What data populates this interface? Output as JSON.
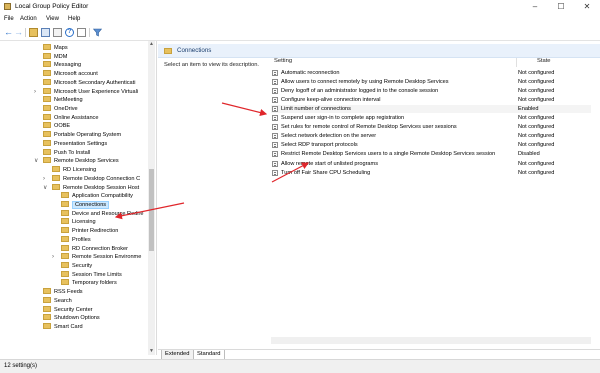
{
  "window": {
    "title": "Local Group Policy Editor",
    "min": "–",
    "max": "☐",
    "close": "✕"
  },
  "menu": [
    "File",
    "Action",
    "View",
    "Help"
  ],
  "tree": [
    {
      "label": "Maps",
      "depth": 1,
      "chev": ""
    },
    {
      "label": "MDM",
      "depth": 1,
      "chev": ""
    },
    {
      "label": "Messaging",
      "depth": 1,
      "chev": ""
    },
    {
      "label": "Microsoft account",
      "depth": 1,
      "chev": ""
    },
    {
      "label": "Microsoft Secondary Authenticati",
      "depth": 1,
      "chev": ""
    },
    {
      "label": "Microsoft User Experience Virtuali",
      "depth": 1,
      "chev": ">"
    },
    {
      "label": "NetMeeting",
      "depth": 1,
      "chev": ""
    },
    {
      "label": "OneDrive",
      "depth": 1,
      "chev": ""
    },
    {
      "label": "Online Assistance",
      "depth": 1,
      "chev": ""
    },
    {
      "label": "OOBE",
      "depth": 1,
      "chev": ""
    },
    {
      "label": "Portable Operating System",
      "depth": 1,
      "chev": ""
    },
    {
      "label": "Presentation Settings",
      "depth": 1,
      "chev": ""
    },
    {
      "label": "Push To Install",
      "depth": 1,
      "chev": ""
    },
    {
      "label": "Remote Desktop Services",
      "depth": 1,
      "chev": "v"
    },
    {
      "label": "RD Licensing",
      "depth": 2,
      "chev": ""
    },
    {
      "label": "Remote Desktop Connection C",
      "depth": 2,
      "chev": ">"
    },
    {
      "label": "Remote Desktop Session Host",
      "depth": 2,
      "chev": "v"
    },
    {
      "label": "Application Compatibility",
      "depth": 3,
      "chev": ""
    },
    {
      "label": "Connections",
      "depth": 3,
      "chev": "",
      "selected": true
    },
    {
      "label": "Device and Resource Redire",
      "depth": 3,
      "chev": ""
    },
    {
      "label": "Licensing",
      "depth": 3,
      "chev": ""
    },
    {
      "label": "Printer Redirection",
      "depth": 3,
      "chev": ""
    },
    {
      "label": "Profiles",
      "depth": 3,
      "chev": ""
    },
    {
      "label": "RD Connection Broker",
      "depth": 3,
      "chev": ""
    },
    {
      "label": "Remote Session Environme",
      "depth": 3,
      "chev": ">"
    },
    {
      "label": "Security",
      "depth": 3,
      "chev": ""
    },
    {
      "label": "Session Time Limits",
      "depth": 3,
      "chev": ""
    },
    {
      "label": "Temporary folders",
      "depth": 3,
      "chev": ""
    },
    {
      "label": "RSS Feeds",
      "depth": 1,
      "chev": ""
    },
    {
      "label": "Search",
      "depth": 1,
      "chev": ""
    },
    {
      "label": "Security Center",
      "depth": 1,
      "chev": ""
    },
    {
      "label": "Shutdown Options",
      "depth": 1,
      "chev": ""
    },
    {
      "label": "Smart Card",
      "depth": 1,
      "chev": ""
    }
  ],
  "pane": {
    "header": "Connections",
    "description": "Select an item to view its description.",
    "col_setting": "Setting",
    "col_state": "State"
  },
  "settings": [
    {
      "name": "Automatic reconnection",
      "state": "Not configured"
    },
    {
      "name": "Allow users to connect remotely by using Remote Desktop Services",
      "state": "Not configured"
    },
    {
      "name": "Deny logoff of an administrator logged in to the console session",
      "state": "Not configured"
    },
    {
      "name": "Configure keep-alive connection interval",
      "state": "Not configured"
    },
    {
      "name": "Limit number of connections",
      "state": "Enabled"
    },
    {
      "name": "Suspend user sign-in to complete app registration",
      "state": "Not configured"
    },
    {
      "name": "Set rules for remote control of Remote Desktop Services user sessions",
      "state": "Not configured"
    },
    {
      "name": "Select network detection on the server",
      "state": "Not configured"
    },
    {
      "name": "Select RDP transport protocols",
      "state": "Not configured"
    },
    {
      "name": "Restrict Remote Desktop Services users to a single Remote Desktop Services session",
      "state": "Disabled"
    },
    {
      "name": "Allow remote start of unlisted programs",
      "state": "Not configured"
    },
    {
      "name": "Turn off Fair Share CPU Scheduling",
      "state": "Not configured"
    }
  ],
  "tabs": [
    "Extended",
    "Standard"
  ],
  "status": "12 setting(s)",
  "colors": {
    "arrow": "#e0262b",
    "selection": "#cce8ff",
    "folder": "#e7c15e"
  }
}
